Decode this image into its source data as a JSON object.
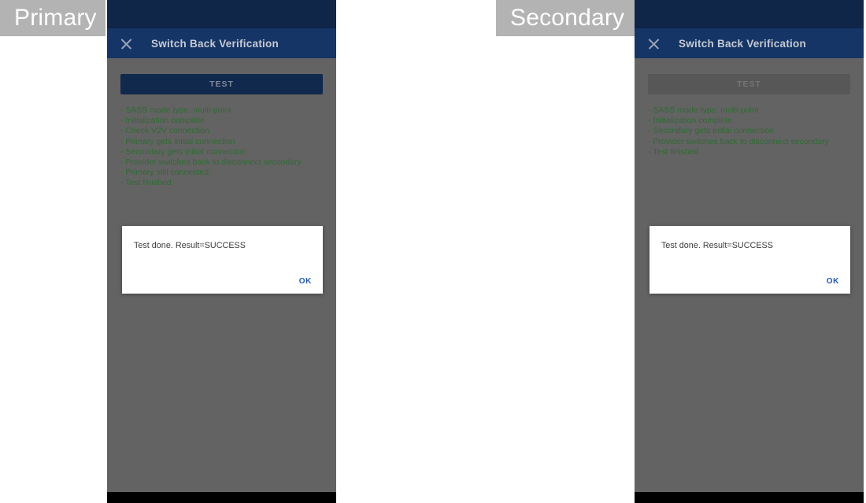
{
  "panels": [
    {
      "role_label": "Primary",
      "titlebar": {
        "close_icon": "close-icon",
        "title": "Switch Back Verification"
      },
      "test_button": {
        "label": "TEST",
        "enabled": true
      },
      "log_lines": [
        "- SASS mode type: multi-point",
        "- Initialization complete",
        "- Check V2V connection.",
        "- Primary gets initial connection",
        "- Secondary gets initial connection",
        "- Provider switches back to disconnect secondary",
        "- Primary still connected.",
        "- Test finished"
      ],
      "dialog": {
        "message": "Test done. Result=SUCCESS",
        "ok_label": "OK"
      }
    },
    {
      "role_label": "Secondary",
      "titlebar": {
        "close_icon": "close-icon",
        "title": "Switch Back Verification"
      },
      "test_button": {
        "label": "TEST",
        "enabled": false
      },
      "log_lines": [
        "- SASS mode type: multi-point",
        "- Initialization complete",
        "- Secondary gets initial connection",
        "- Provider switches back to disconnect secondary",
        "- Test finished"
      ],
      "dialog": {
        "message": "Test done. Result=SUCCESS",
        "ok_label": "OK"
      }
    }
  ],
  "colors": {
    "statusbar": "#0f2649",
    "titlebar": "#153566",
    "scrim": "#636363",
    "log_green": "#2f6b33",
    "dialog_action": "#2156c8",
    "button_enabled": "#12294e",
    "button_disabled": "#575757",
    "chip_background": "#b3b3b3",
    "navbar": "#000000"
  }
}
